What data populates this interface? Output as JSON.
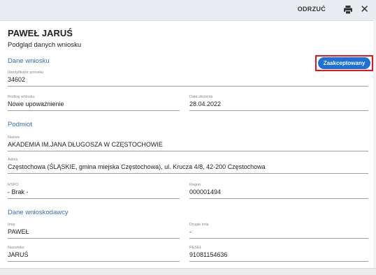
{
  "toolbar": {
    "reject_label": "ODRZUĆ",
    "print_icon": "print-icon",
    "close_icon": "close-icon",
    "close_glyph": "✕"
  },
  "header": {
    "name": "PAWEŁ JARUŚ",
    "subtitle": "Podgląd danych wniosku"
  },
  "status_button": {
    "label": "Zaakceptowany",
    "color": "#1e6fd6",
    "highlight": "#e3151a"
  },
  "sections": {
    "application": "Dane wniosku",
    "entity": "Podmiot",
    "applicant": "Dane wnioskodawcy"
  },
  "fields": {
    "app_id": {
      "label": "Identyfikator wniosku",
      "value": "34602"
    },
    "app_type": {
      "label": "Rodzaj wniosku",
      "value": "Nowe upoważnienie"
    },
    "app_date": {
      "label": "Data złożenia",
      "value": "28.04.2022"
    },
    "entity_name": {
      "label": "Nazwa",
      "value": "AKADEMIA IM.JANA DŁUGOSZA W CZĘSTOCHOWIE"
    },
    "entity_address": {
      "label": "Adres",
      "value": "Częstochowa (ŚLĄSKIE, gmina miejska Częstochowa), ul. Krucza 4/8, 42-200 Częstochowa"
    },
    "rspo": {
      "label": "RSPO",
      "value": "- Brak -"
    },
    "regon": {
      "label": "Regon",
      "value": "000001494"
    },
    "first_name": {
      "label": "Imię",
      "value": "PAWEŁ"
    },
    "second_name": {
      "label": "Drugie imię",
      "value": "-"
    },
    "surname": {
      "label": "Nazwisko",
      "value": "JARUŚ"
    },
    "pesel": {
      "label": "PESEL",
      "value": "91081154636"
    }
  }
}
